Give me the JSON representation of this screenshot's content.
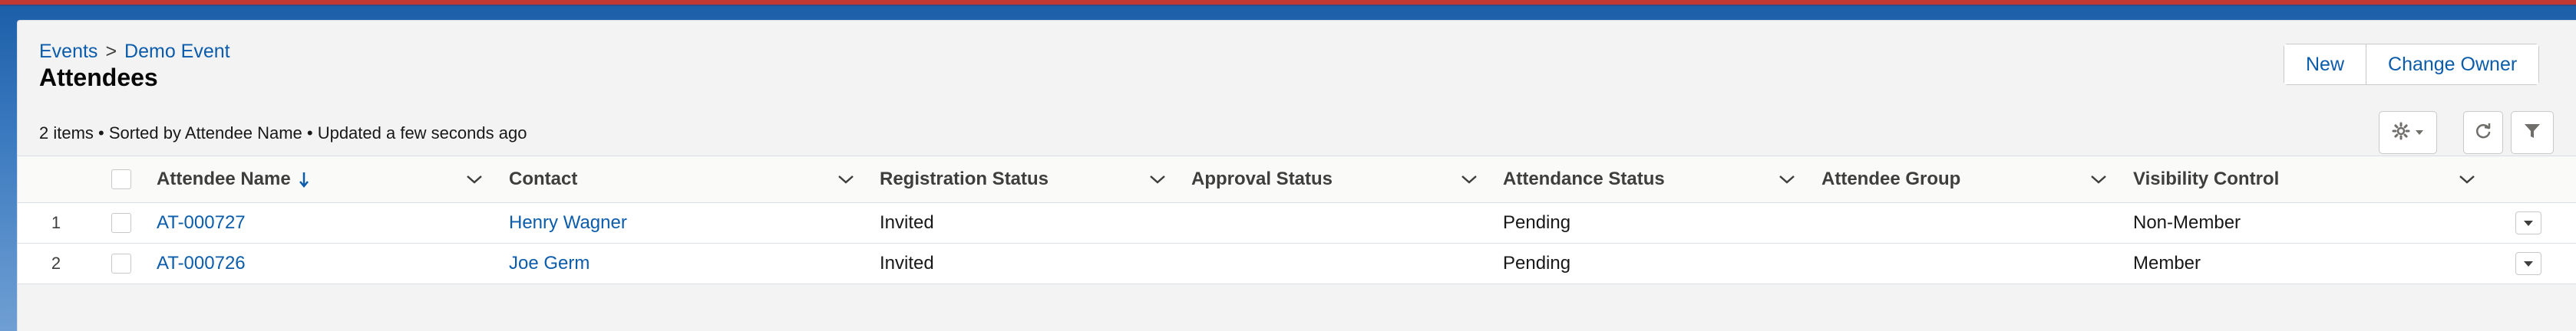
{
  "breadcrumb": {
    "parent": "Events",
    "separator": ">",
    "current": "Demo Event"
  },
  "page": {
    "title": "Attendees",
    "meta": "2 items • Sorted by Attendee Name • Updated a few seconds ago"
  },
  "actions": {
    "new_label": "New",
    "change_owner_label": "Change Owner"
  },
  "toolbar_icons": [
    "gear-icon",
    "refresh-icon",
    "filter-icon"
  ],
  "columns": [
    "Attendee Name",
    "Contact",
    "Registration Status",
    "Approval Status",
    "Attendance Status",
    "Attendee Group",
    "Visibility Control"
  ],
  "sort": {
    "column": "Attendee Name",
    "direction": "descending"
  },
  "rows": [
    {
      "num": "1",
      "attendee_name": "AT-000727",
      "contact": "Henry Wagner",
      "registration_status": "Invited",
      "approval_status": "",
      "attendance_status": "Pending",
      "attendee_group": "",
      "visibility_control": "Non-Member"
    },
    {
      "num": "2",
      "attendee_name": "AT-000726",
      "contact": "Joe Germ",
      "registration_status": "Invited",
      "approval_status": "",
      "attendance_status": "Pending",
      "attendee_group": "",
      "visibility_control": "Member"
    }
  ],
  "colors": {
    "link": "#0b5cab",
    "header_bg": "#fafaf9",
    "border": "#d8dde6",
    "page_bg": "#f3f3f3"
  }
}
